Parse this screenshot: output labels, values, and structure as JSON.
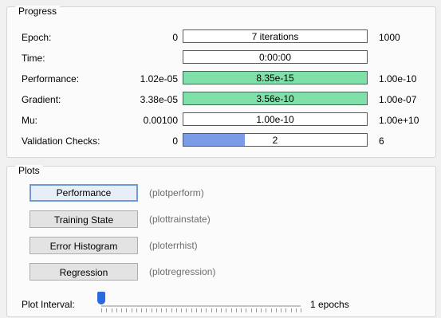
{
  "progress": {
    "title": "Progress",
    "rows": [
      {
        "label": "Epoch:",
        "initial": "0",
        "value": "7 iterations",
        "target": "1000",
        "fill_fraction": 0,
        "fill_color": "#7fe0a9"
      },
      {
        "label": "Time:",
        "initial": "",
        "value": "0:00:00",
        "target": "",
        "fill_fraction": 0,
        "fill_color": "#7fe0a9"
      },
      {
        "label": "Performance:",
        "initial": "1.02e-05",
        "value": "8.35e-15",
        "target": "1.00e-10",
        "fill_fraction": 1,
        "fill_color": "#7fe0a9"
      },
      {
        "label": "Gradient:",
        "initial": "3.38e-05",
        "value": "3.56e-10",
        "target": "1.00e-07",
        "fill_fraction": 1,
        "fill_color": "#7fe0a9"
      },
      {
        "label": "Mu:",
        "initial": "0.00100",
        "value": "1.00e-10",
        "target": "1.00e+10",
        "fill_fraction": 0,
        "fill_color": "#7fe0a9"
      },
      {
        "label": "Validation Checks:",
        "initial": "0",
        "value": "2",
        "target": "6",
        "fill_fraction": 0.333,
        "fill_color": "#7b9be6"
      }
    ]
  },
  "plots": {
    "title": "Plots",
    "buttons": [
      {
        "label": "Performance",
        "function": "(plotperform)"
      },
      {
        "label": "Training State",
        "function": "(plottrainstate)"
      },
      {
        "label": "Error Histogram",
        "function": "(ploterrhist)"
      },
      {
        "label": "Regression",
        "function": "(plotregression)"
      }
    ],
    "interval_label": "Plot Interval:",
    "interval_value": "1 epochs",
    "interval_fraction": 0
  }
}
